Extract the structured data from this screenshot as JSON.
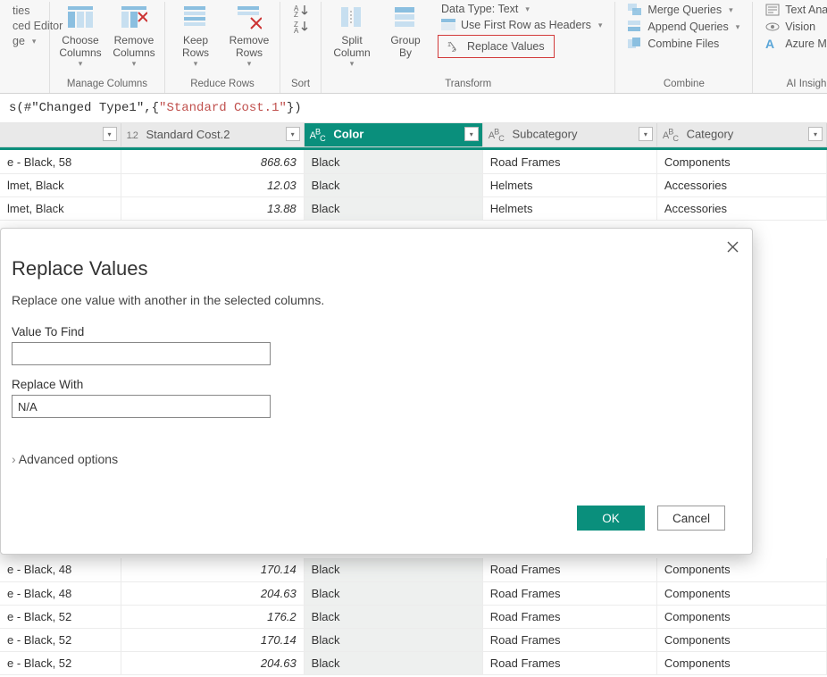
{
  "ribbon": {
    "left_cropped": {
      "ties": "ties",
      "editor": "ced Editor",
      "ge": "ge"
    },
    "choose_columns": "Choose\nColumns",
    "remove_columns": "Remove\nColumns",
    "manage_columns": "Manage Columns",
    "keep_rows": "Keep\nRows",
    "remove_rows": "Remove\nRows",
    "reduce_rows": "Reduce Rows",
    "sort": "Sort",
    "split_column": "Split\nColumn",
    "group_by": "Group\nBy",
    "data_type": "Data Type: Text",
    "first_row_headers": "Use First Row as Headers",
    "replace_values": "Replace Values",
    "transform": "Transform",
    "merge_queries": "Merge Queries",
    "append_queries": "Append Queries",
    "combine_files": "Combine Files",
    "combine": "Combine",
    "text_analytics": "Text Analytic",
    "vision": "Vision",
    "azure_ml": "Azure Mach",
    "ai_insights": "AI Insigh"
  },
  "formula": {
    "fn": "s(",
    "arg1": "#\"Changed Type1\"",
    "mid": ",{",
    "arg2": "\"Standard Cost.1\"",
    "end": "})"
  },
  "columns": [
    {
      "type": "",
      "name": ""
    },
    {
      "type": "1.2",
      "name": "Standard Cost.2"
    },
    {
      "type": "ABC",
      "name": "Color",
      "selected": true
    },
    {
      "type": "ABC",
      "name": "Subcategory"
    },
    {
      "type": "ABC",
      "name": "Category"
    }
  ],
  "rows_top": [
    {
      "c0": "e - Black, 58",
      "c1": "868.63",
      "c2": "Black",
      "c3": "Road Frames",
      "c4": "Components"
    },
    {
      "c0": "lmet, Black",
      "c1": "12.03",
      "c2": "Black",
      "c3": "Helmets",
      "c4": "Accessories"
    },
    {
      "c0": "lmet, Black",
      "c1": "13.88",
      "c2": "Black",
      "c3": "Helmets",
      "c4": "Accessories"
    }
  ],
  "rows_bottom": [
    {
      "c0": "e - Black, 48",
      "c1": "170.14",
      "c2": "Black",
      "c3": "Road Frames",
      "c4": "Components"
    },
    {
      "c0": "e - Black, 48",
      "c1": "204.63",
      "c2": "Black",
      "c3": "Road Frames",
      "c4": "Components"
    },
    {
      "c0": "e - Black, 52",
      "c1": "176.2",
      "c2": "Black",
      "c3": "Road Frames",
      "c4": "Components"
    },
    {
      "c0": "e - Black, 52",
      "c1": "170.14",
      "c2": "Black",
      "c3": "Road Frames",
      "c4": "Components"
    },
    {
      "c0": "e - Black, 52",
      "c1": "204.63",
      "c2": "Black",
      "c3": "Road Frames",
      "c4": "Components"
    }
  ],
  "dialog": {
    "title": "Replace Values",
    "subtitle": "Replace one value with another in the selected columns.",
    "value_to_find_label": "Value To Find",
    "value_to_find": "",
    "replace_with_label": "Replace With",
    "replace_with": "N/A",
    "advanced": "Advanced options",
    "ok": "OK",
    "cancel": "Cancel"
  }
}
